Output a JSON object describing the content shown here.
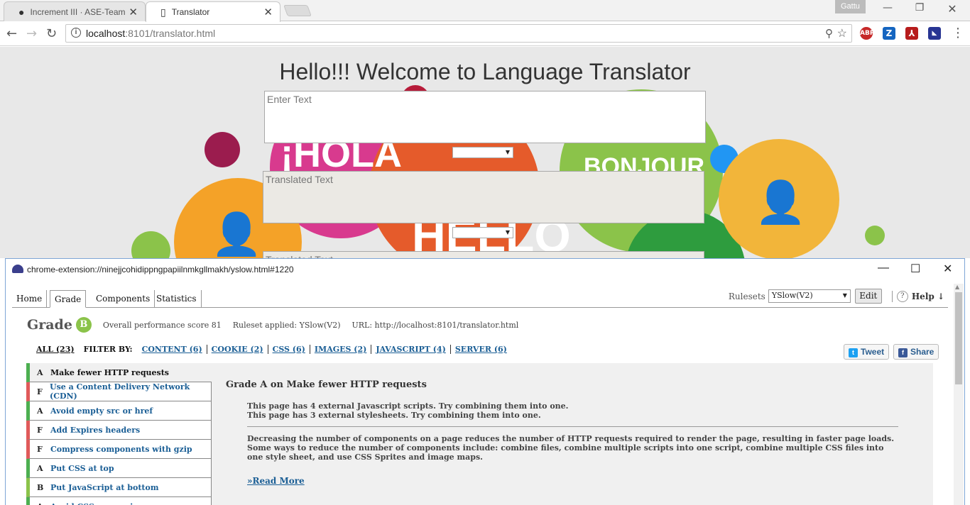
{
  "browser": {
    "tabs": [
      {
        "title": "Increment III · ASE-Team",
        "icon": "github-icon"
      },
      {
        "title": "Translator",
        "icon": "page-icon"
      }
    ],
    "profile_name": "Gattu",
    "url_host": "localhost",
    "url_rest": ":8101/translator.html"
  },
  "page": {
    "title": "Hello!!! Welcome to Language Translator",
    "input_placeholder": "Enter Text",
    "output_placeholder": "Translated Text",
    "output2_placeholder": "Translated Text",
    "background_words": [
      "¡HOLA",
      "BONJOUR",
      "HELLO"
    ]
  },
  "yslow": {
    "window_title": "chrome-extension://ninejjcohidippngpapiilnmkgllmakh/yslow.html#1220",
    "tabs": [
      "Home",
      "Grade",
      "Components",
      "Statistics"
    ],
    "active_tab": "Grade",
    "rulesets_label": "Rulesets",
    "ruleset_value": "YSlow(V2)",
    "edit_label": "Edit",
    "help_label": "Help ↓",
    "grade_word": "Grade",
    "grade_letter": "B",
    "score_text": "Overall performance score 81",
    "ruleset_text": "Ruleset applied: YSlow(V2)",
    "url_text": "URL: http://localhost:8101/translator.html",
    "filter_all": "ALL (23)",
    "filter_by": "FILTER BY:",
    "filters": [
      "CONTENT (6)",
      "COOKIE (2)",
      "CSS (6)",
      "IMAGES (2)",
      "JAVASCRIPT (4)",
      "SERVER (6)"
    ],
    "tweet_label": "Tweet",
    "share_label": "Share",
    "rules": [
      {
        "grade": "A",
        "name": "Make fewer HTTP requests",
        "color": "#4caf50"
      },
      {
        "grade": "F",
        "name": "Use a Content Delivery Network (CDN)",
        "color": "#e05a5a"
      },
      {
        "grade": "A",
        "name": "Avoid empty src or href",
        "color": "#4caf50"
      },
      {
        "grade": "F",
        "name": "Add Expires headers",
        "color": "#e05a5a"
      },
      {
        "grade": "F",
        "name": "Compress components with gzip",
        "color": "#e05a5a"
      },
      {
        "grade": "A",
        "name": "Put CSS at top",
        "color": "#4caf50"
      },
      {
        "grade": "B",
        "name": "Put JavaScript at bottom",
        "color": "#8bc34a"
      },
      {
        "grade": "A",
        "name": "Avoid CSS expressions",
        "color": "#4caf50"
      }
    ],
    "detail": {
      "title": "Grade A on Make fewer HTTP requests",
      "line1": "This page has 4 external Javascript scripts. Try combining them into one.",
      "line2": "This page has 3 external stylesheets. Try combining them into one.",
      "paragraph": "Decreasing the number of components on a page reduces the number of HTTP requests required to render the page, resulting in faster page loads. Some ways to reduce the number of components include: combine files, combine multiple scripts into one script, combine multiple CSS files into one style sheet, and use CSS Sprites and image maps.",
      "read_more": "»Read More"
    }
  }
}
